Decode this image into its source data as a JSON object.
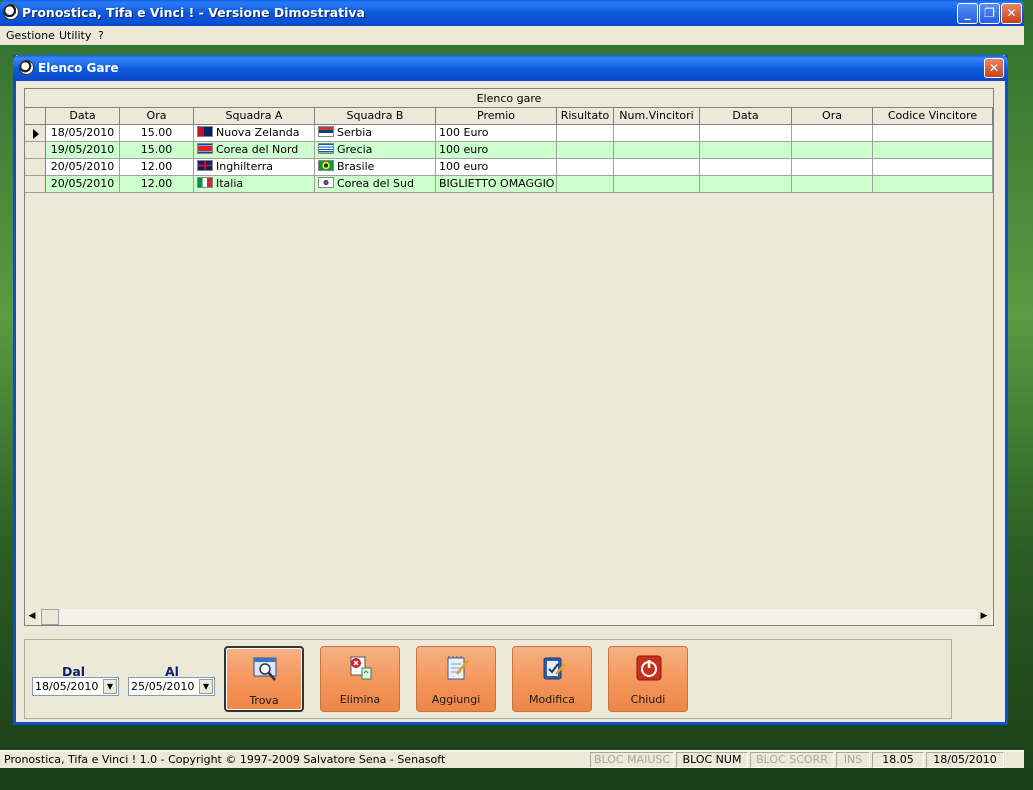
{
  "app": {
    "title": "Pronostica, Tifa e Vinci ! - Versione Dimostrativa",
    "menu": [
      "Gestione",
      "Utility",
      "?"
    ]
  },
  "window": {
    "title": "Elenco Gare"
  },
  "grid": {
    "caption": "Elenco gare",
    "columns": [
      "Data",
      "Ora",
      "Squadra A",
      "Squadra B",
      "Premio",
      "Risultato",
      "Num.Vincitori",
      "Data",
      "Ora",
      "Codice Vincitore"
    ],
    "rows": [
      {
        "data": "18/05/2010",
        "ora": "15.00",
        "squadra_a": "Nuova Zelanda",
        "flag_a": "new-zealand-flag",
        "squadra_b": "Serbia",
        "flag_b": "serbia-flag",
        "premio": "100 Euro",
        "selected": true
      },
      {
        "data": "19/05/2010",
        "ora": "15.00",
        "squadra_a": "Corea del Nord",
        "flag_a": "north-korea-flag",
        "squadra_b": "Grecia",
        "flag_b": "greece-flag",
        "premio": "100 euro",
        "selected": false
      },
      {
        "data": "20/05/2010",
        "ora": "12.00",
        "squadra_a": "Inghilterra",
        "flag_a": "england-flag",
        "squadra_b": "Brasile",
        "flag_b": "brazil-flag",
        "premio": "100 euro",
        "selected": false
      },
      {
        "data": "20/05/2010",
        "ora": "12.00",
        "squadra_a": "Italia",
        "flag_a": "italy-flag",
        "squadra_b": "Corea del Sud",
        "flag_b": "south-korea-flag",
        "premio": "BIGLIETTO OMAGGIO",
        "selected": false
      }
    ]
  },
  "filter": {
    "dal_label": "Dal",
    "al_label": "Al",
    "dal_value": "18/05/2010",
    "al_value": "25/05/2010"
  },
  "actions": {
    "trova": "Trova",
    "elimina": "Elimina",
    "aggiungi": "Aggiungi",
    "modifica": "Modifica",
    "chiudi": "Chiudi"
  },
  "statusbar": {
    "copyright": "Pronostica, Tifa e Vinci ! 1.0 - Copyright © 1997-2009 Salvatore Sena - Senasoft",
    "caps": "BLOC MAIUSC",
    "num": "BLOC NUM",
    "scroll": "BLOC SCORR",
    "ins": "INS",
    "time": "18.05",
    "date": "18/05/2010"
  },
  "colors": {
    "titlebar": "#0a5ee8",
    "row_alt": "#ccffcc",
    "button": "#f5975d"
  }
}
